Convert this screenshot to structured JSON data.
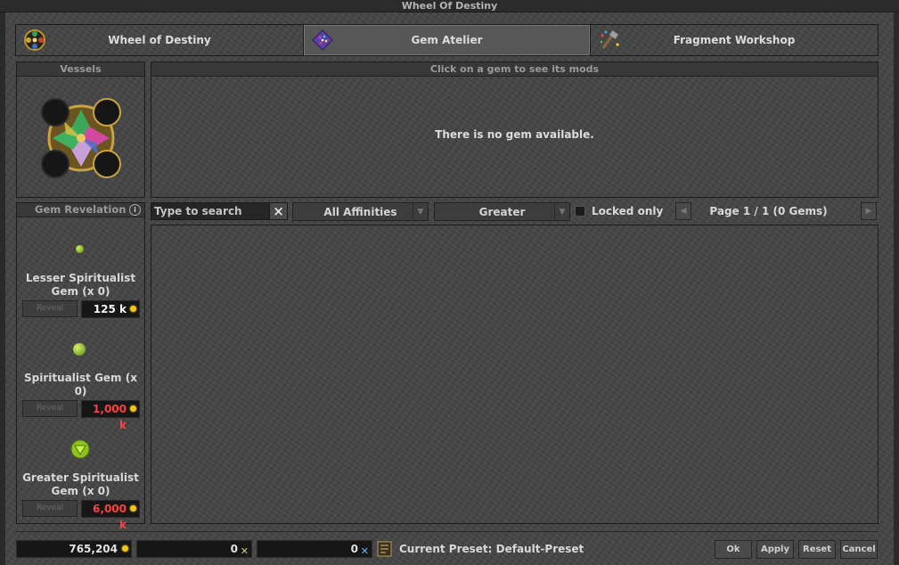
{
  "window": {
    "title": "Wheel Of Destiny"
  },
  "tabs": [
    {
      "label": "Wheel of Destiny",
      "icon": "wheel-icon"
    },
    {
      "label": "Gem Atelier",
      "icon": "gem-atelier-icon"
    },
    {
      "label": "Fragment Workshop",
      "icon": "fragment-workshop-icon"
    }
  ],
  "vessels": {
    "title": "Vessels"
  },
  "mods_panel": {
    "title": "Click on a gem to see its mods",
    "empty_message": "There is no gem available."
  },
  "revelation": {
    "title": "Gem Revelation",
    "gems": [
      {
        "name": "Lesser Spiritualist Gem (x 0)",
        "button": "Reveal",
        "price": "125 k",
        "price_color": "#f2f2f2"
      },
      {
        "name": "Spiritualist Gem (x 0)",
        "button": "Reveal",
        "price": "1,000 k",
        "price_color": "#ff4040"
      },
      {
        "name": "Greater Spiritualist Gem (x 0)",
        "button": "Reveal",
        "price": "6,000 k",
        "price_color": "#ff4040"
      }
    ]
  },
  "filters": {
    "search_placeholder": "Type to search",
    "affinity": "All Affinities",
    "quality": "Greater",
    "locked_only": "Locked only",
    "page": "Page 1 / 1 (0 Gems)"
  },
  "bottom": {
    "gold": "765,204",
    "fragments_lesser": "0",
    "fragments_greater": "0",
    "preset": "Current Preset: Default-Preset",
    "buttons": [
      "Ok",
      "Apply",
      "Reset",
      "Cancel"
    ]
  },
  "colors": {
    "accent_gold": "#f6c21a",
    "error_red": "#ff4040",
    "gem_green": "#8dc21f"
  }
}
